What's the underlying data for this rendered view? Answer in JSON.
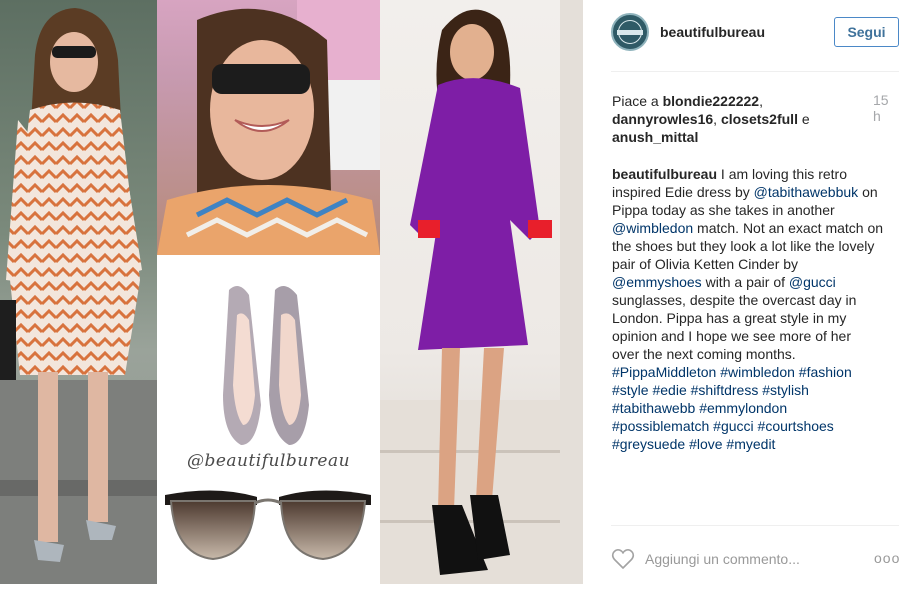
{
  "post": {
    "username": "beautifulbureau",
    "follow_label": "Segui",
    "likes": {
      "prefix": "Piace a",
      "users": [
        "blondie222222",
        "dannyrowles16",
        "closets2full",
        "anush_mittal"
      ],
      "conjunction": "e"
    },
    "time_ago": "15 h",
    "caption": {
      "user": "beautifulbureau",
      "lines": [
        "I am loving this retro",
        "inspired Edie dress by @tabithawebbuk on",
        "Pippa today as she takes in another",
        "@wimbledon match. Not an exact match on",
        "the shoes but they look a lot like the lovely",
        "pair of Olivia Ketten Cinder by",
        "@emmyshoes with a pair of @gucci",
        "sunglasses, despite the overcast day in",
        "London. Pippa has a great style in my",
        "opinion and I hope we see more of her",
        "over the next coming months.",
        "#PippaMiddleton #wimbledon #fashion",
        "#style #edie #shiftdress #stylish",
        "#tabithawebb #emmylondon",
        "#possiblematch #gucci #courtshoes",
        "#greysuede #love #myedit"
      ]
    },
    "image": {
      "watermark": "@beautifulbureau"
    },
    "comment_placeholder": "Aggiungi un commento...",
    "more_label": "ooo"
  },
  "colors": {
    "link": "#003569",
    "follow_border": "#4b88c7",
    "follow_text": "#3f729b",
    "timestamp": "#a5a7aa"
  }
}
